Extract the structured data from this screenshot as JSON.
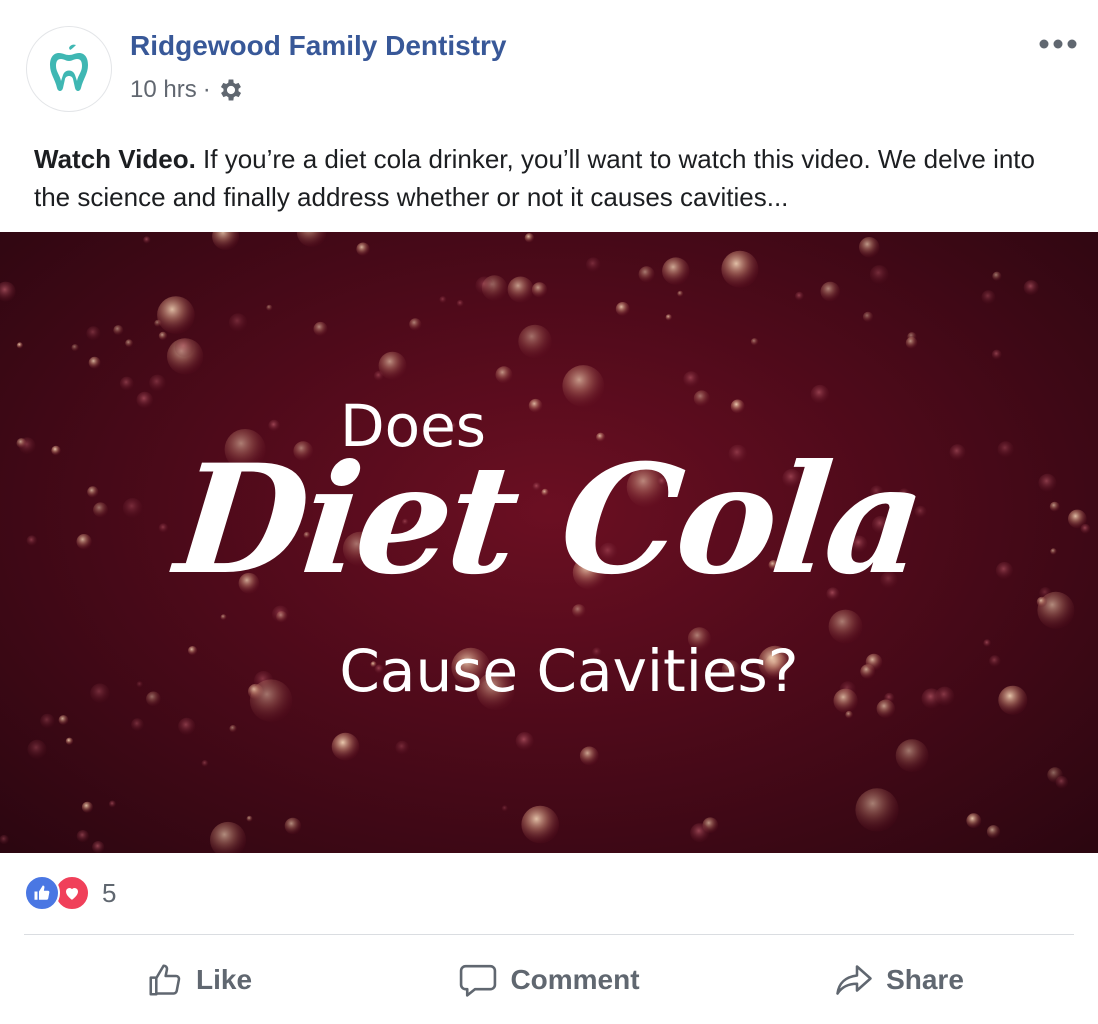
{
  "header": {
    "page_name": "Ridgewood Family Dentistry",
    "time": "10 hrs",
    "separator": "·",
    "avatar_icon": "tooth-apple-icon",
    "privacy_icon": "gear-icon",
    "more_icon": "more-horizontal-icon"
  },
  "post": {
    "lead": "Watch Video.",
    "body": " If you’re a diet cola drinker, you’ll want to watch this video. We delve into the science and finally address whether or not it causes cavities..."
  },
  "video": {
    "line1": "Does",
    "line2": "Diet Cola",
    "line3": "Cause Cavities?",
    "background_color": "#4e0a1a"
  },
  "reactions": {
    "count": "5",
    "types": [
      "like-icon",
      "love-icon"
    ]
  },
  "actions": {
    "like_label": "Like",
    "comment_label": "Comment",
    "share_label": "Share"
  },
  "colors": {
    "link": "#385898",
    "muted": "#606770",
    "like": "#4a77e3",
    "love": "#f0405a"
  }
}
